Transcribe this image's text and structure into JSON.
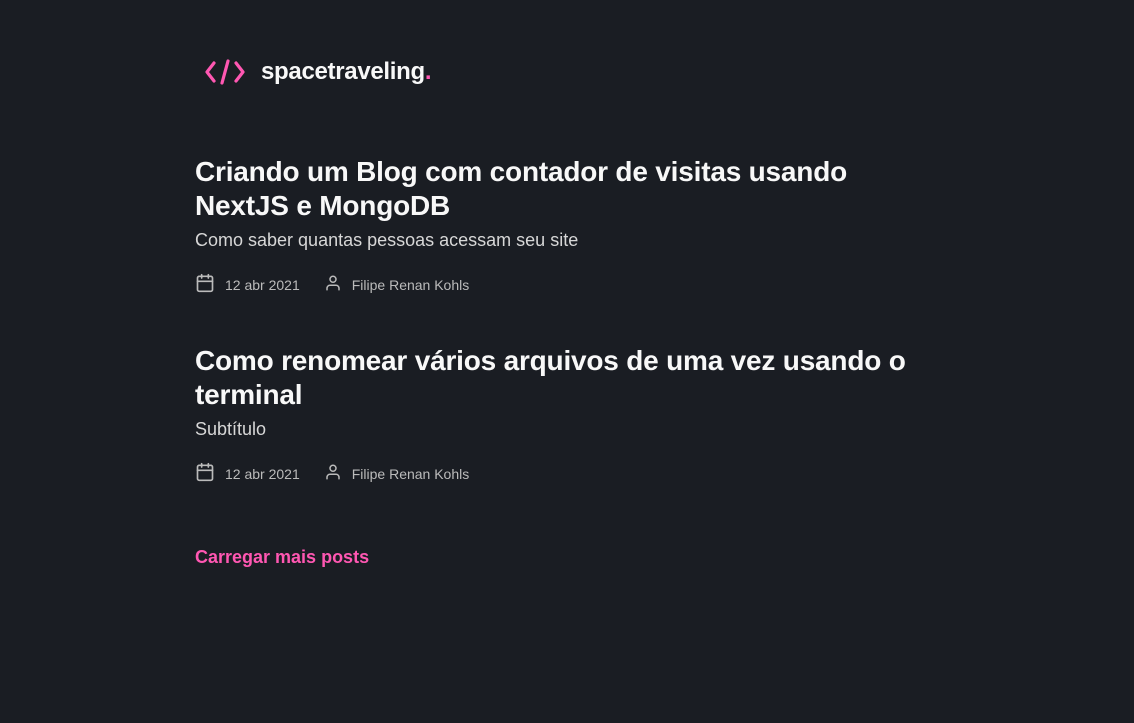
{
  "header": {
    "logo_text": "spacetraveling",
    "logo_dot": "."
  },
  "posts": [
    {
      "title": "Criando um Blog com contador de visitas usando NextJS e MongoDB",
      "subtitle": "Como saber quantas pessoas acessam seu site",
      "date": "12 abr 2021",
      "author": "Filipe Renan Kohls"
    },
    {
      "title": "Como renomear vários arquivos de uma vez usando o terminal",
      "subtitle": "Subtítulo",
      "date": "12 abr 2021",
      "author": "Filipe Renan Kohls"
    }
  ],
  "load_more_label": "Carregar mais posts",
  "colors": {
    "background": "#1A1D23",
    "accent": "#FF57B2",
    "heading": "#F8F8F8",
    "body": "#D7D7D7",
    "meta": "#BBBBBB"
  },
  "icons": {
    "logo": "code-brackets-icon",
    "date": "calendar-icon",
    "author": "user-icon"
  }
}
